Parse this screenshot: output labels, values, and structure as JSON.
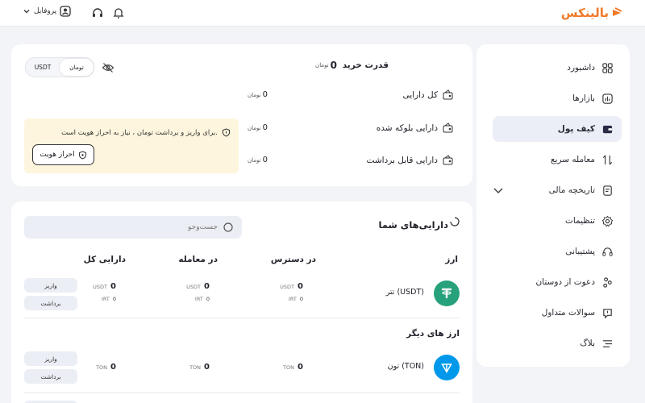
{
  "topbar": {
    "logo_text": "بالینکس",
    "profile_label": "پروفایل"
  },
  "sidebar": {
    "items": [
      {
        "label": "داشبورد",
        "icon": "dashboard-icon"
      },
      {
        "label": "بازارها",
        "icon": "markets-icon"
      },
      {
        "label": "کیف پول",
        "icon": "wallet-icon",
        "active": true
      },
      {
        "label": "معامله سریع",
        "icon": "swap-icon"
      },
      {
        "label": "تاریخچه مالی",
        "icon": "history-icon"
      },
      {
        "label": "تنظیمات",
        "icon": "gear-icon"
      },
      {
        "label": "پشتیبانی",
        "icon": "headset-icon"
      },
      {
        "label": "دعوت از دوستان",
        "icon": "invite-icon"
      },
      {
        "label": "سوالات متداول",
        "icon": "faq-icon"
      },
      {
        "label": "بلاگ",
        "icon": "blog-icon"
      }
    ]
  },
  "summary": {
    "purchase_power_label": "قدرت خرید",
    "purchase_power_value": "0",
    "toman_mark": "تومان",
    "currency_toggle": {
      "options": [
        "USDT",
        "تومان"
      ],
      "selected": "تومان"
    },
    "rows": [
      {
        "label": "کل دارایی",
        "value": "0"
      },
      {
        "label": "دارایی بلوکه شده",
        "value": "0"
      },
      {
        "label": "دارایی قابل برداشت",
        "value": "0"
      }
    ],
    "notice_text": "برای واریز و برداشت تومان ، نیاز به احراز هویت است.",
    "kyc_button": "احراز هویت"
  },
  "assets": {
    "title": "دارایی‌های شما",
    "search_placeholder": "جست‌وجو",
    "columns": {
      "currency": "ارز",
      "available": "در دسترس",
      "in_trade": "در معامله",
      "total": "دارایی کل"
    },
    "other_title": "ارز های دیگر",
    "deposit_label": "واریز",
    "withdraw_label": "برداشت",
    "coins": [
      {
        "name": "تتر (USDT)",
        "color": "#26a17b",
        "available": {
          "value": "0",
          "unit": "USDT",
          "irt": "0",
          "irt_unit": "IRT"
        },
        "in_trade": {
          "value": "0",
          "unit": "USDT",
          "irt": "0",
          "irt_unit": "IRT"
        },
        "total": {
          "value": "0",
          "unit": "USDT",
          "irt": "0",
          "irt_unit": "IRT"
        }
      },
      {
        "name": "تون (TON)",
        "color": "#0098ea",
        "available": {
          "value": "0",
          "unit": "TON"
        },
        "in_trade": {
          "value": "0",
          "unit": "TON"
        },
        "total": {
          "value": "0",
          "unit": "TON"
        }
      }
    ]
  },
  "colors": {
    "brand": "#f07a2a",
    "notice_bg": "#fdf5dd",
    "active_nav": "#eceef7"
  }
}
